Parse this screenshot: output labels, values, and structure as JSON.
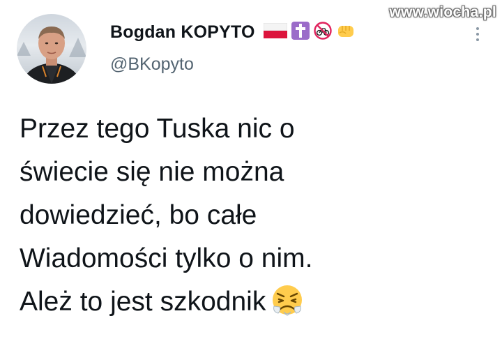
{
  "author": {
    "display_name": "Bogdan KOPYTO",
    "handle": "@BKopyto",
    "badges": [
      "poland-flag-icon",
      "cross-icon",
      "no-bicycle-icon",
      "fist-icon"
    ]
  },
  "watermark": "www.wiocha.pl",
  "tweet": {
    "lines": [
      "Przez tego Tuska nic o",
      "świecie się nie można",
      "dowiedzieć, bo całe",
      "Wiadomości tylko o nim.",
      "Ależ to jest szkodnik"
    ],
    "trailing_emoji": "persevering-face-icon"
  },
  "colors": {
    "text": "#0f1419",
    "handle": "#536471",
    "flag_red": "#dc143c",
    "cross_bg": "#9b6cc9"
  }
}
